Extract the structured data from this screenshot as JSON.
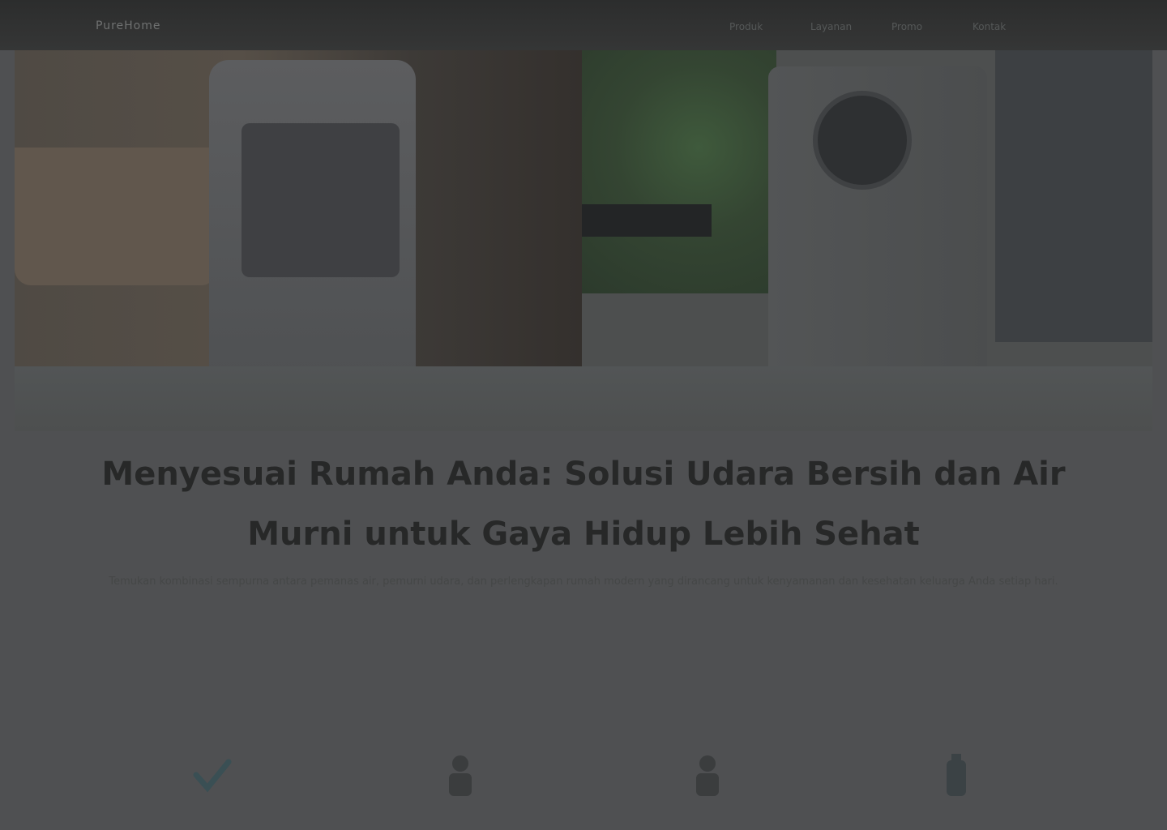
{
  "header": {
    "logo": "PureHome",
    "nav": [
      "Produk",
      "Layanan",
      "Promo",
      "Kontak"
    ]
  },
  "hero": {
    "title": "Menyesuai Rumah Anda: Solusi Udara Bersih dan Air Murni untuk Gaya Hidup Lebih Sehat",
    "subtitle": "Temukan kombinasi sempurna antara pemanas air, pemurni udara, dan perlengkapan rumah modern yang dirancang untuk kenyamanan dan kesehatan keluarga Anda setiap hari."
  },
  "features": [
    {
      "icon": "check-icon"
    },
    {
      "icon": "person-icon"
    },
    {
      "icon": "person-icon"
    },
    {
      "icon": "bottle-icon"
    }
  ]
}
